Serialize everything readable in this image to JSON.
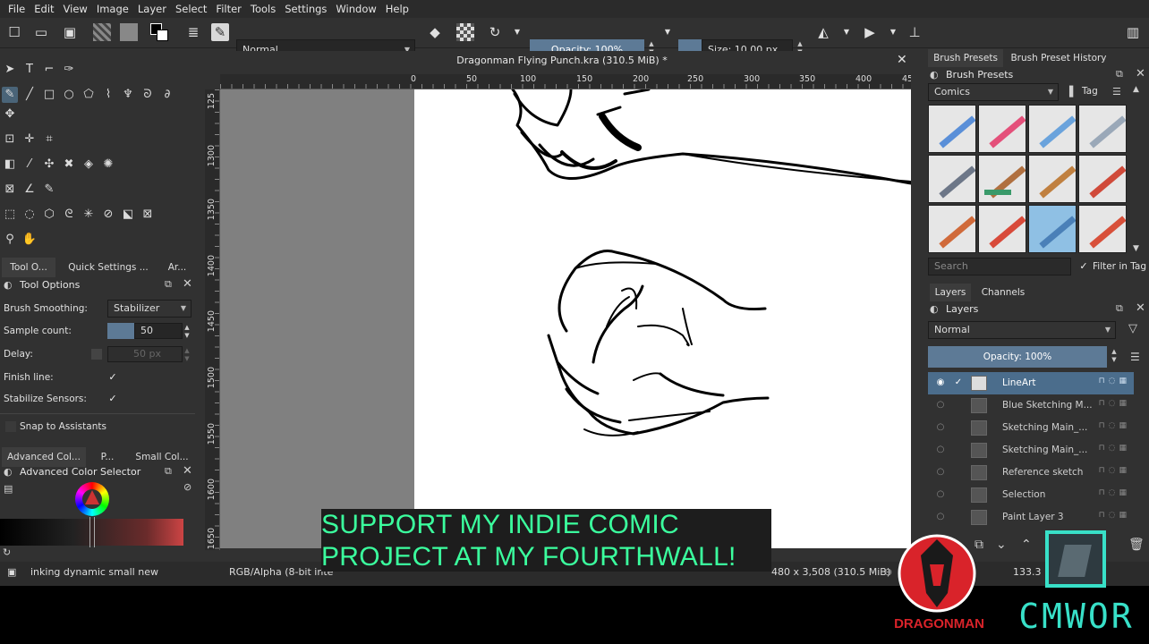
{
  "menu": [
    "File",
    "Edit",
    "View",
    "Image",
    "Layer",
    "Select",
    "Filter",
    "Tools",
    "Settings",
    "Window",
    "Help"
  ],
  "toolbar": {
    "blend_mode": "Normal",
    "opacity": "Opacity: 100%",
    "size": "Size: 10.00 px"
  },
  "document": {
    "title": "Dragonman Flying Punch.kra (310.5 MiB) *",
    "h_ruler": [
      "0",
      "50",
      "100",
      "150",
      "200",
      "250",
      "300",
      "350",
      "400",
      "45"
    ],
    "v_ruler": [
      "125",
      "1300",
      "1350",
      "1400",
      "1450",
      "1500",
      "1550",
      "1600",
      "1650"
    ]
  },
  "left_tabs": [
    "Tool O...",
    "Quick Settings ...",
    "Ar..."
  ],
  "tool_options": {
    "title": "Tool Options",
    "brush_smoothing_label": "Brush Smoothing:",
    "brush_smoothing_value": "Stabilizer",
    "sample_count_label": "Sample count:",
    "sample_count_value": "50",
    "delay_label": "Delay:",
    "delay_value": "50 px",
    "finish_line_label": "Finish line:",
    "stabilize_sensors_label": "Stabilize Sensors:",
    "snap_label": "Snap to Assistants"
  },
  "color_tabs": [
    "Advanced Col...",
    "P...",
    "Small Col..."
  ],
  "color_selector_title": "Advanced Color Selector",
  "right_top_tabs": [
    "Brush Presets",
    "Brush Preset History"
  ],
  "brush_presets": {
    "title": "Brush Presets",
    "tag": "Comics",
    "tag_button": "Tag",
    "search_placeholder": "Search",
    "filter_label": "Filter in Tag"
  },
  "layers_tabs": [
    "Layers",
    "Channels"
  ],
  "layers_panel": {
    "title": "Layers",
    "blend_mode": "Normal",
    "opacity": "Opacity:  100%",
    "items": [
      "LineArt",
      "Blue Sketching M...",
      "Sketching Main_...",
      "Sketching Main_...",
      "Reference sketch",
      "Selection",
      "Paint Layer 3"
    ]
  },
  "status": {
    "brush": "inking dynamic small new",
    "color_model": "RGB/Alpha (8-bit inte",
    "dimensions": "480 x 3,508 (310.5 MiB)",
    "zoom": "133.3"
  },
  "banner": {
    "line1": "SUPPORT MY INDIE COMIC",
    "line2": "PROJECT AT MY FOURTHWALL!"
  },
  "brand_left": "DRAGONMAN",
  "brand_right": "CMWOR",
  "colors": {
    "accent": "#5d7a96",
    "selection": "#4b6d8c",
    "banner_text": "#3bff9e",
    "brand_red": "#d9232a",
    "brand_teal": "#38e0c8"
  }
}
